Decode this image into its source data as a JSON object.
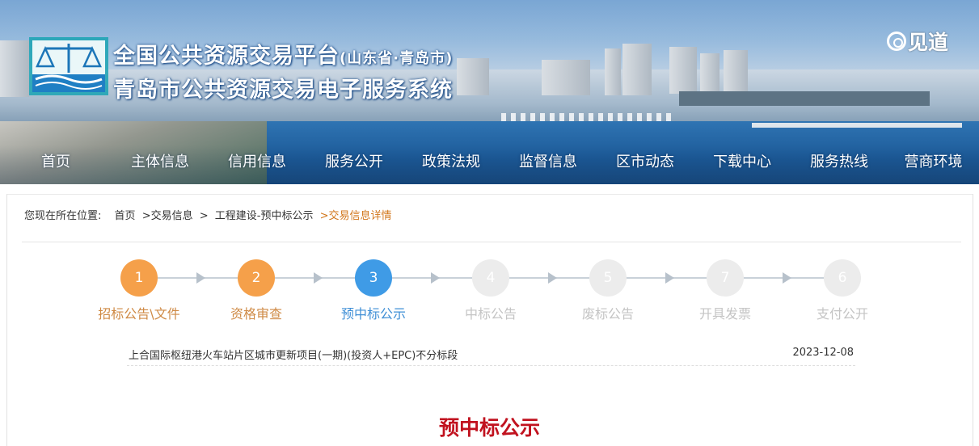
{
  "header": {
    "title_main": "全国公共资源交易平台",
    "title_region": "(山东省·青岛市)",
    "title_sub": "青岛市公共资源交易电子服务系统",
    "watermark": "见道"
  },
  "nav": {
    "items": [
      {
        "label": "首页"
      },
      {
        "label": "主体信息"
      },
      {
        "label": "信用信息"
      },
      {
        "label": "服务公开"
      },
      {
        "label": "政策法规"
      },
      {
        "label": "监督信息"
      },
      {
        "label": "区市动态"
      },
      {
        "label": "下载中心"
      },
      {
        "label": "服务热线"
      },
      {
        "label": "营商环境"
      }
    ]
  },
  "breadcrumb": {
    "prefix": "您现在所在位置:",
    "items": [
      "首页",
      ">交易信息",
      ">",
      "工程建设-预中标公示",
      ">交易信息详情"
    ]
  },
  "steps": {
    "items": [
      {
        "number": "1",
        "label": "招标公告\\文件",
        "state": "done"
      },
      {
        "number": "2",
        "label": "资格审查",
        "state": "done"
      },
      {
        "number": "3",
        "label": "预中标公示",
        "state": "current"
      },
      {
        "number": "4",
        "label": "中标公告",
        "state": "pending"
      },
      {
        "number": "5",
        "label": "废标公告",
        "state": "pending"
      },
      {
        "number": "7",
        "label": "开具发票",
        "state": "pending"
      },
      {
        "number": "6",
        "label": "支付公开",
        "state": "pending"
      }
    ]
  },
  "colors": {
    "done": "#f5a04a",
    "done_text": "#cf8a45",
    "current": "#3f9be6",
    "current_text": "#3f8fd6",
    "pending": "#ececec",
    "pending_text": "#c4c4c4",
    "heading": "#c1121f",
    "breadcrumb_current": "#d2771c"
  },
  "project": {
    "name": "上合国际枢纽港火车站片区城市更新项目(一期)(投资人+EPC)不分标段",
    "date": "2023-12-08"
  },
  "page": {
    "heading": "预中标公示"
  }
}
